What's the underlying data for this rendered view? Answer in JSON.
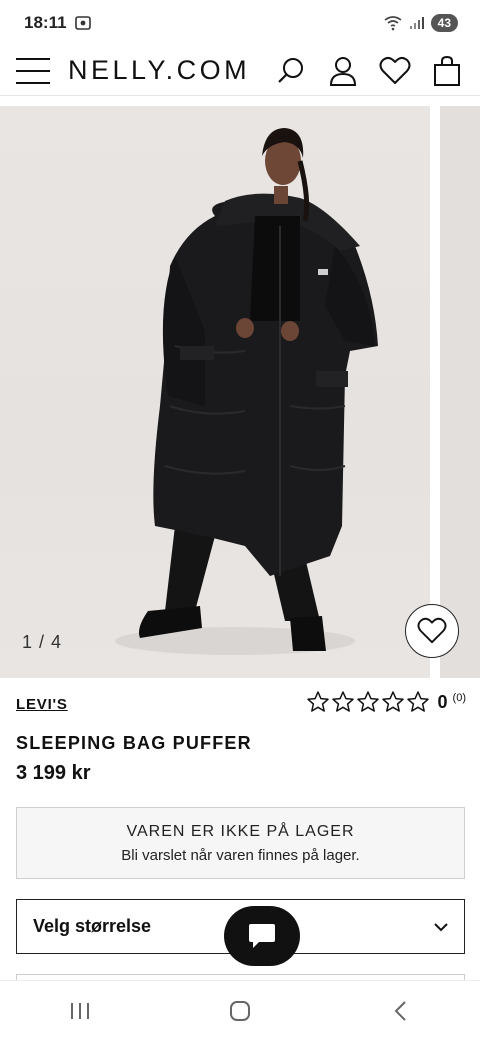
{
  "status_bar": {
    "time": "18:11",
    "battery": "43"
  },
  "header": {
    "logo": "NELLY.COM"
  },
  "gallery": {
    "counter": "1 / 4"
  },
  "product": {
    "brand": "LEVI'S",
    "title": "SLEEPING BAG PUFFER",
    "price": "3 199 kr",
    "rating": {
      "score": "0",
      "reviews": "(0)",
      "stars_filled": 0,
      "stars_total": 5
    }
  },
  "stock": {
    "title": "VAREN ER IKKE PÅ LAGER",
    "subtitle": "Bli varslet når varen finnes på lager."
  },
  "size_select": {
    "label": "Velg størrelse"
  },
  "icons": {
    "menu": "hamburger-menu-icon",
    "search": "search-icon",
    "account": "user-icon",
    "wishlist": "heart-icon",
    "bag": "shopping-bag-icon",
    "chat": "chat-bubble-icon"
  },
  "colors": {
    "text": "#111111",
    "stock_bg": "#f6f6f6",
    "photo_bg": "#e8e4e1"
  }
}
